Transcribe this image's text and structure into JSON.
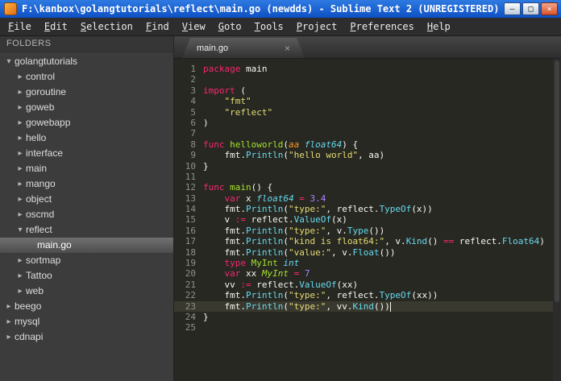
{
  "window": {
    "title": "F:\\kanbox\\golangtutorials\\reflect\\main.go (newdds) - Sublime Text 2 (UNREGISTERED)",
    "controls": {
      "minimize": "–",
      "maximize": "□",
      "close": "×"
    }
  },
  "menu": {
    "items": [
      "File",
      "Edit",
      "Selection",
      "Find",
      "View",
      "Goto",
      "Tools",
      "Project",
      "Preferences",
      "Help"
    ]
  },
  "sidebar": {
    "header": "FOLDERS",
    "items": [
      {
        "label": "golangtutorials",
        "level": 0,
        "state": "expanded",
        "type": "folder",
        "selected": false
      },
      {
        "label": "control",
        "level": 1,
        "state": "collapsed",
        "type": "folder",
        "selected": false
      },
      {
        "label": "goroutine",
        "level": 1,
        "state": "collapsed",
        "type": "folder",
        "selected": false
      },
      {
        "label": "goweb",
        "level": 1,
        "state": "collapsed",
        "type": "folder",
        "selected": false
      },
      {
        "label": "gowebapp",
        "level": 1,
        "state": "collapsed",
        "type": "folder",
        "selected": false
      },
      {
        "label": "hello",
        "level": 1,
        "state": "collapsed",
        "type": "folder",
        "selected": false
      },
      {
        "label": "interface",
        "level": 1,
        "state": "collapsed",
        "type": "folder",
        "selected": false
      },
      {
        "label": "main",
        "level": 1,
        "state": "collapsed",
        "type": "folder",
        "selected": false
      },
      {
        "label": "mango",
        "level": 1,
        "state": "collapsed",
        "type": "folder",
        "selected": false
      },
      {
        "label": "object",
        "level": 1,
        "state": "collapsed",
        "type": "folder",
        "selected": false
      },
      {
        "label": "oscmd",
        "level": 1,
        "state": "collapsed",
        "type": "folder",
        "selected": false
      },
      {
        "label": "reflect",
        "level": 1,
        "state": "expanded",
        "type": "folder",
        "selected": false
      },
      {
        "label": "main.go",
        "level": 2,
        "state": "none",
        "type": "file",
        "selected": true
      },
      {
        "label": "sortmap",
        "level": 1,
        "state": "collapsed",
        "type": "folder",
        "selected": false
      },
      {
        "label": "Tattoo",
        "level": 1,
        "state": "collapsed",
        "type": "folder",
        "selected": false
      },
      {
        "label": "web",
        "level": 1,
        "state": "collapsed",
        "type": "folder",
        "selected": false
      },
      {
        "label": "beego",
        "level": 0,
        "state": "collapsed",
        "type": "folder",
        "selected": false
      },
      {
        "label": "mysql",
        "level": 0,
        "state": "collapsed",
        "type": "folder",
        "selected": false
      },
      {
        "label": "cdnapi",
        "level": 0,
        "state": "collapsed",
        "type": "folder",
        "selected": false
      }
    ]
  },
  "editor": {
    "tab": {
      "label": "main.go",
      "close": "×"
    },
    "code": {
      "current_line": 23,
      "lines": [
        {
          "num": 1,
          "tokens": [
            {
              "t": "package",
              "c": "kw"
            },
            {
              "t": " main",
              "c": "pl"
            }
          ]
        },
        {
          "num": 2,
          "tokens": []
        },
        {
          "num": 3,
          "tokens": [
            {
              "t": "import",
              "c": "kw"
            },
            {
              "t": " (",
              "c": "pl"
            }
          ]
        },
        {
          "num": 4,
          "tokens": [
            {
              "t": "    ",
              "c": "pl"
            },
            {
              "t": "\"fmt\"",
              "c": "str"
            }
          ]
        },
        {
          "num": 5,
          "tokens": [
            {
              "t": "    ",
              "c": "pl"
            },
            {
              "t": "\"reflect\"",
              "c": "str"
            }
          ]
        },
        {
          "num": 6,
          "tokens": [
            {
              "t": ")",
              "c": "pl"
            }
          ]
        },
        {
          "num": 7,
          "tokens": []
        },
        {
          "num": 8,
          "tokens": [
            {
              "t": "func",
              "c": "kw"
            },
            {
              "t": " ",
              "c": "pl"
            },
            {
              "t": "helloworld",
              "c": "fn"
            },
            {
              "t": "(",
              "c": "pl"
            },
            {
              "t": "aa",
              "c": "par"
            },
            {
              "t": " ",
              "c": "pl"
            },
            {
              "t": "float64",
              "c": "typ"
            },
            {
              "t": ") {",
              "c": "pl"
            }
          ]
        },
        {
          "num": 9,
          "tokens": [
            {
              "t": "    fmt.",
              "c": "pl"
            },
            {
              "t": "Println",
              "c": "call"
            },
            {
              "t": "(",
              "c": "pl"
            },
            {
              "t": "\"hello world\"",
              "c": "str"
            },
            {
              "t": ", aa)",
              "c": "pl"
            }
          ]
        },
        {
          "num": 10,
          "tokens": [
            {
              "t": "}",
              "c": "pl"
            }
          ]
        },
        {
          "num": 11,
          "tokens": []
        },
        {
          "num": 12,
          "tokens": [
            {
              "t": "func",
              "c": "kw"
            },
            {
              "t": " ",
              "c": "pl"
            },
            {
              "t": "main",
              "c": "fn"
            },
            {
              "t": "() {",
              "c": "pl"
            }
          ]
        },
        {
          "num": 13,
          "tokens": [
            {
              "t": "    ",
              "c": "pl"
            },
            {
              "t": "var",
              "c": "kw"
            },
            {
              "t": " x ",
              "c": "pl"
            },
            {
              "t": "float64",
              "c": "typ"
            },
            {
              "t": " ",
              "c": "pl"
            },
            {
              "t": "=",
              "c": "op"
            },
            {
              "t": " ",
              "c": "pl"
            },
            {
              "t": "3.4",
              "c": "num"
            }
          ]
        },
        {
          "num": 14,
          "tokens": [
            {
              "t": "    fmt.",
              "c": "pl"
            },
            {
              "t": "Println",
              "c": "call"
            },
            {
              "t": "(",
              "c": "pl"
            },
            {
              "t": "\"type:\"",
              "c": "str"
            },
            {
              "t": ", reflect.",
              "c": "pl"
            },
            {
              "t": "TypeOf",
              "c": "call"
            },
            {
              "t": "(x))",
              "c": "pl"
            }
          ]
        },
        {
          "num": 15,
          "tokens": [
            {
              "t": "    v ",
              "c": "pl"
            },
            {
              "t": ":=",
              "c": "op"
            },
            {
              "t": " reflect.",
              "c": "pl"
            },
            {
              "t": "ValueOf",
              "c": "call"
            },
            {
              "t": "(x)",
              "c": "pl"
            }
          ]
        },
        {
          "num": 16,
          "tokens": [
            {
              "t": "    fmt.",
              "c": "pl"
            },
            {
              "t": "Println",
              "c": "call"
            },
            {
              "t": "(",
              "c": "pl"
            },
            {
              "t": "\"type:\"",
              "c": "str"
            },
            {
              "t": ", v.",
              "c": "pl"
            },
            {
              "t": "Type",
              "c": "call"
            },
            {
              "t": "())",
              "c": "pl"
            }
          ]
        },
        {
          "num": 17,
          "tokens": [
            {
              "t": "    fmt.",
              "c": "pl"
            },
            {
              "t": "Println",
              "c": "call"
            },
            {
              "t": "(",
              "c": "pl"
            },
            {
              "t": "\"kind is float64:\"",
              "c": "str"
            },
            {
              "t": ", v.",
              "c": "pl"
            },
            {
              "t": "Kind",
              "c": "call"
            },
            {
              "t": "() ",
              "c": "pl"
            },
            {
              "t": "==",
              "c": "op"
            },
            {
              "t": " reflect.",
              "c": "pl"
            },
            {
              "t": "Float64",
              "c": "call"
            },
            {
              "t": ")",
              "c": "pl"
            }
          ]
        },
        {
          "num": 18,
          "tokens": [
            {
              "t": "    fmt.",
              "c": "pl"
            },
            {
              "t": "Println",
              "c": "call"
            },
            {
              "t": "(",
              "c": "pl"
            },
            {
              "t": "\"value:\"",
              "c": "str"
            },
            {
              "t": ", v.",
              "c": "pl"
            },
            {
              "t": "Float",
              "c": "call"
            },
            {
              "t": "())",
              "c": "pl"
            }
          ]
        },
        {
          "num": 19,
          "tokens": [
            {
              "t": "    ",
              "c": "pl"
            },
            {
              "t": "type",
              "c": "kw"
            },
            {
              "t": " ",
              "c": "pl"
            },
            {
              "t": "MyInt",
              "c": "fn"
            },
            {
              "t": " ",
              "c": "pl"
            },
            {
              "t": "int",
              "c": "typ"
            }
          ]
        },
        {
          "num": 20,
          "tokens": [
            {
              "t": "    ",
              "c": "pl"
            },
            {
              "t": "var",
              "c": "kw"
            },
            {
              "t": " xx ",
              "c": "pl"
            },
            {
              "t": "MyInt",
              "c": "typu"
            },
            {
              "t": " ",
              "c": "pl"
            },
            {
              "t": "=",
              "c": "op"
            },
            {
              "t": " ",
              "c": "pl"
            },
            {
              "t": "7",
              "c": "num"
            }
          ]
        },
        {
          "num": 21,
          "tokens": [
            {
              "t": "    vv ",
              "c": "pl"
            },
            {
              "t": ":=",
              "c": "op"
            },
            {
              "t": " reflect.",
              "c": "pl"
            },
            {
              "t": "ValueOf",
              "c": "call"
            },
            {
              "t": "(xx)",
              "c": "pl"
            }
          ]
        },
        {
          "num": 22,
          "tokens": [
            {
              "t": "    fmt.",
              "c": "pl"
            },
            {
              "t": "Println",
              "c": "call"
            },
            {
              "t": "(",
              "c": "pl"
            },
            {
              "t": "\"type:\"",
              "c": "str"
            },
            {
              "t": ", reflect.",
              "c": "pl"
            },
            {
              "t": "TypeOf",
              "c": "call"
            },
            {
              "t": "(xx))",
              "c": "pl"
            }
          ]
        },
        {
          "num": 23,
          "tokens": [
            {
              "t": "    fmt.",
              "c": "pl"
            },
            {
              "t": "Println",
              "c": "call"
            },
            {
              "t": "(",
              "c": "pl"
            },
            {
              "t": "\"type:\"",
              "c": "str"
            },
            {
              "t": ", vv.",
              "c": "pl"
            },
            {
              "t": "Kind",
              "c": "call"
            },
            {
              "t": "())",
              "c": "pl"
            },
            {
              "t": "",
              "c": "cursor"
            }
          ]
        },
        {
          "num": 24,
          "tokens": [
            {
              "t": "}",
              "c": "pl"
            }
          ]
        },
        {
          "num": 25,
          "tokens": []
        }
      ]
    }
  },
  "colors": {
    "titlebar_blue": "#1a5fd0",
    "editor_background": "#272822",
    "sidebar_background": "#3c3c3c",
    "sidebar_selection": "#5f5f5f",
    "current_line_highlight": "#3a392f",
    "syntax": {
      "keyword": "#f92672",
      "string": "#e6db74",
      "number": "#ae81ff",
      "function_call": "#66d9ef",
      "builtin_type": "#66d9ef",
      "declaration_name": "#a6e22e",
      "parameter": "#fd971f",
      "text": "#f8f8f2",
      "line_number": "#8f908a"
    }
  }
}
